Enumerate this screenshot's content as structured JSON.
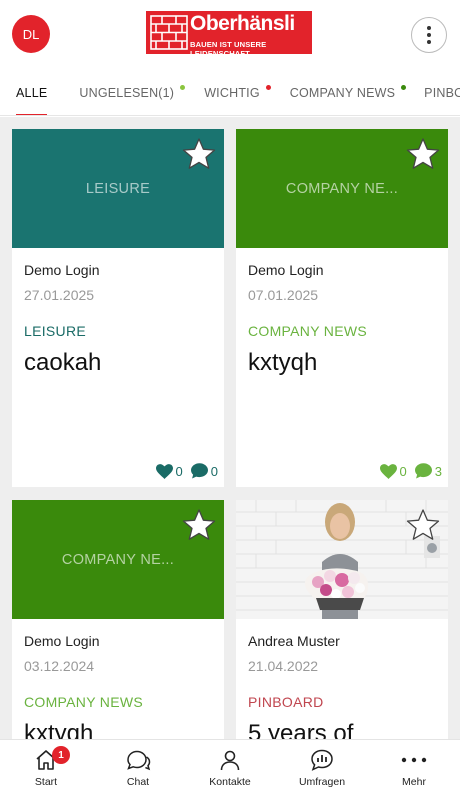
{
  "header": {
    "avatar_initials": "DL",
    "logo": {
      "brand": "Oberhänsli",
      "tagline": "BAUEN IST UNSERE LEIDENSCHAFT",
      "color": "#e2232b"
    },
    "menu_icon": "more-vertical-icon"
  },
  "tabs": [
    {
      "label": "ALLE",
      "active": true,
      "dot": null
    },
    {
      "label": "UNGELESEN(1)",
      "active": false,
      "dot": "#8bc53f"
    },
    {
      "label": "WICHTIG",
      "active": false,
      "dot": "#e2232b"
    },
    {
      "label": "COMPANY NEWS",
      "active": false,
      "dot": "#3a8a0c"
    },
    {
      "label": "PINBOARD",
      "active": false,
      "dot": null
    }
  ],
  "cards": [
    {
      "banner_label": "LEISURE",
      "banner_color": "#1a7470",
      "author": "Demo Login",
      "date": "27.01.2025",
      "category": "LEISURE",
      "category_color": "#1a6b66",
      "title": "caokah",
      "likes": "0",
      "comments": "0",
      "stat_color": "#1a6b66"
    },
    {
      "banner_label": "COMPANY NE...",
      "banner_color": "#3a8a0c",
      "author": "Demo Login",
      "date": "07.01.2025",
      "category": "COMPANY NEWS",
      "category_color": "#6ab33f",
      "title": "kxtyqh",
      "likes": "0",
      "comments": "3",
      "stat_color": "#6ab33f"
    },
    {
      "banner_label": "COMPANY NE...",
      "banner_color": "#3a8a0c",
      "author": "Demo Login",
      "date": "03.12.2024",
      "category": "COMPANY NEWS",
      "category_color": "#6ab33f",
      "title": "kxtyqh"
    },
    {
      "banner_label": "",
      "banner_color": "#f3f3f3",
      "author": "Andrea Muster",
      "date": "21.04.2022",
      "category": "PINBOARD",
      "category_color": "#c0464f",
      "title": "5 years of"
    }
  ],
  "bottom_nav": [
    {
      "label": "Start",
      "icon": "home-icon",
      "badge": "1"
    },
    {
      "label": "Chat",
      "icon": "chat-icon"
    },
    {
      "label": "Kontakte",
      "icon": "contacts-icon"
    },
    {
      "label": "Umfragen",
      "icon": "polls-icon"
    },
    {
      "label": "Mehr",
      "icon": "more-horizontal-icon"
    }
  ]
}
